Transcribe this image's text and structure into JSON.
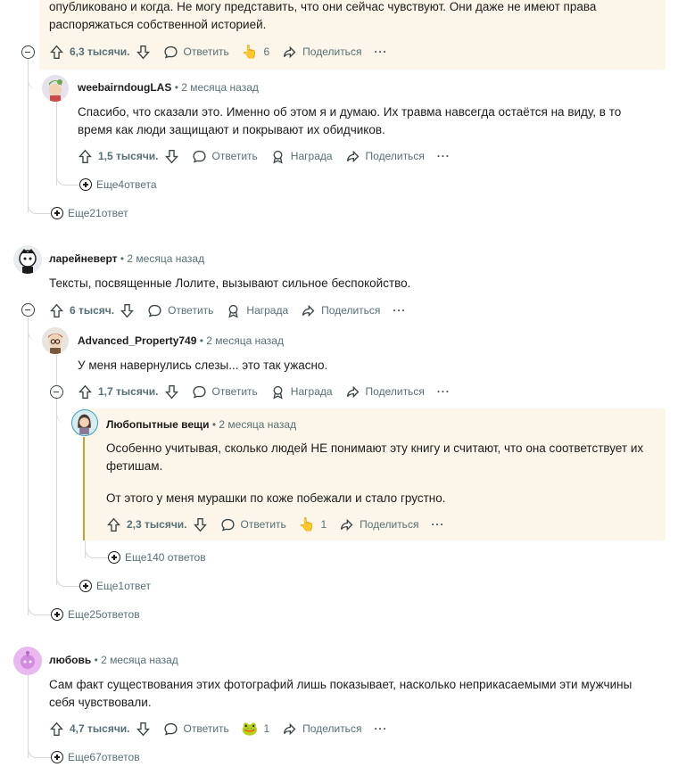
{
  "labels": {
    "reply": "Ответить",
    "share": "Поделиться",
    "award": "Награда",
    "more": "···"
  },
  "c0": {
    "text": "опубликовано и когда. Не могу представить, что они сейчас чувствуют. Они даже не имеют права распоряжаться собственной историей.",
    "votes": "6,3 тысячи.",
    "award_count": "6"
  },
  "c1": {
    "author": "weebairndougLAS",
    "time": "• 2 месяца назад",
    "text": "Спасибо, что сказали это. Именно об этом я и думаю. Их травма навсегда остаётся на виду, в то время как люди защищают и покрывают их обидчиков.",
    "votes": "1,5 тысячи.",
    "more_replies": "Еще4ответа"
  },
  "more_c0": "Еще21ответ",
  "c2": {
    "author": "ларейневерт",
    "time": "• 2 месяца назад",
    "text": "Тексты, посвященные Лолите, вызывают сильное беспокойство.",
    "votes": "6 тысяч."
  },
  "c3": {
    "author": "Advanced_Property749",
    "time": "• 2 месяца назад",
    "text": "У меня навернулись слезы... это так ужасно.",
    "votes": "1,7 тысячи."
  },
  "c4": {
    "author": "Любопытные вещи",
    "time": "• 2 месяца назад",
    "text1": "Особенно учитывая, сколько людей НЕ понимают эту книгу и считают, что она соответствует их фетишам.",
    "text2": "От этого у меня мурашки по коже побежали и стало грустно.",
    "votes": "2,3 тысячи.",
    "award_count": "1",
    "more_replies": "Еще140 ответов"
  },
  "more_c3": "Еще1ответ",
  "more_c2": "Еще25ответов",
  "c5": {
    "author": "любовь",
    "time": "• 2 месяца назад",
    "text": "Сам факт существования этих фотографий лишь показывает, насколько неприкасаемыми эти мужчины себя чувствовали.",
    "votes": "4,7 тысячи.",
    "award_count": "1"
  },
  "more_c5": "Еще67ответов",
  "colors": {
    "highlight": "#fbf6e9",
    "highlight_bar": "#c9a227",
    "meta": "#576f76",
    "thread": "#d4d7d9"
  }
}
